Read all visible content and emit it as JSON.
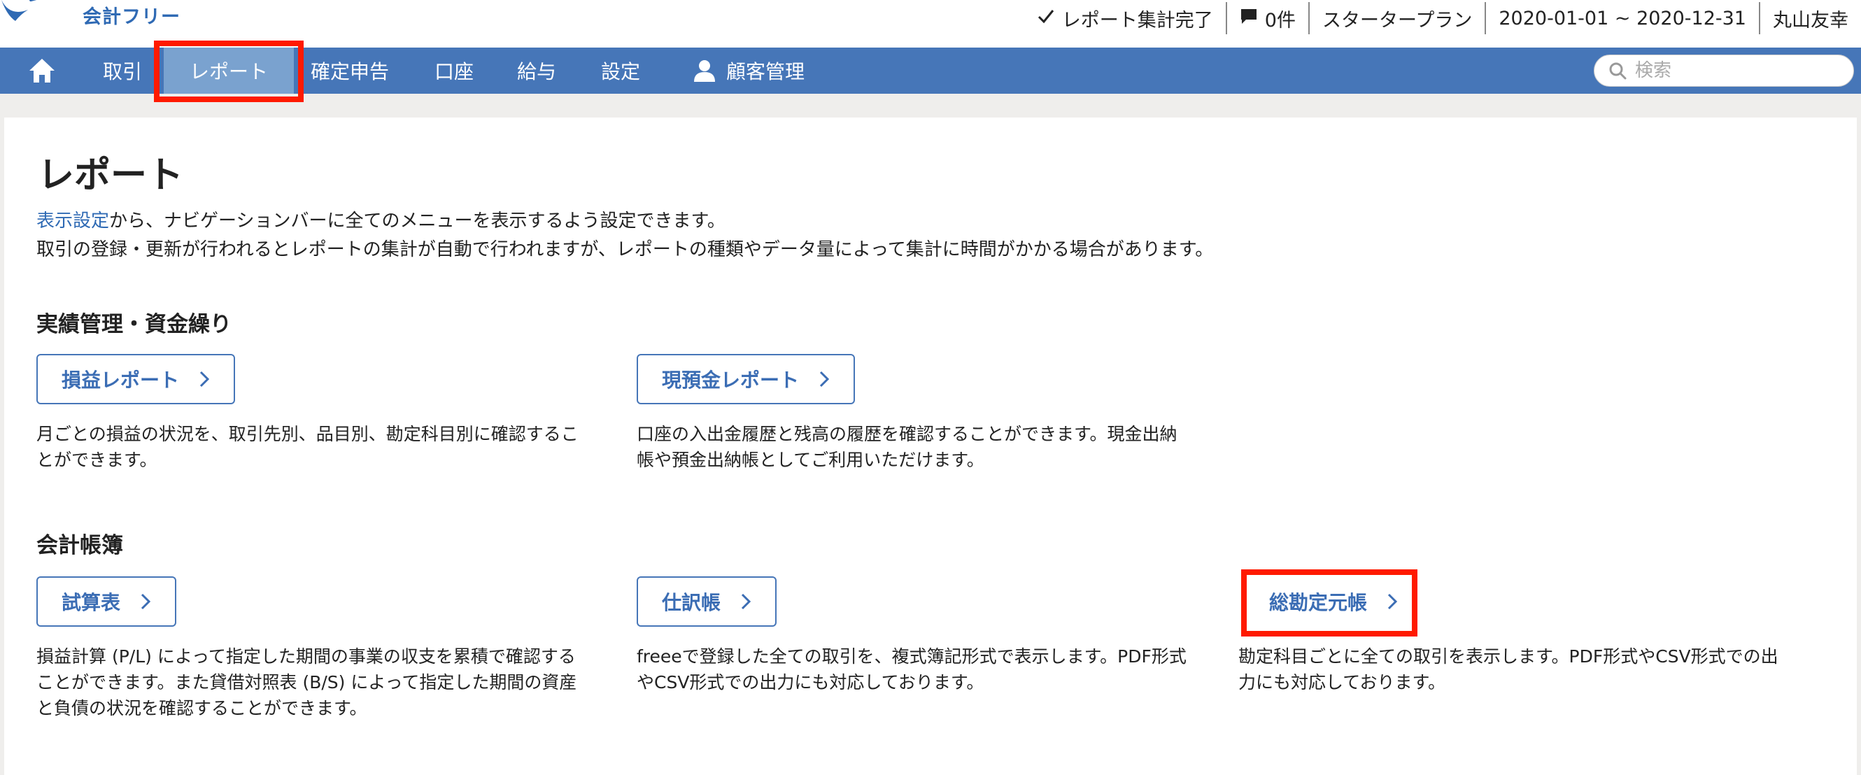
{
  "header": {
    "logo_text": "会計フリー",
    "status": {
      "report_status": "レポート集計完了",
      "message_count": "0件",
      "plan": "スタータープラン",
      "period": "2020-01-01 ~ 2020-12-31",
      "user_name": "丸山友幸"
    }
  },
  "nav": {
    "items": [
      {
        "label": "取引"
      },
      {
        "label": "レポート"
      },
      {
        "label": "確定申告"
      },
      {
        "label": "口座"
      },
      {
        "label": "給与"
      },
      {
        "label": "設定"
      },
      {
        "label": "顧客管理"
      }
    ],
    "active": "レポート",
    "search_placeholder": "検索"
  },
  "page": {
    "title": "レポート",
    "intro_link": "表示設定",
    "intro_line1_rest": "から、ナビゲーションバーに全てのメニューを表示するよう設定できます。",
    "intro_line2": "取引の登録・更新が行われるとレポートの集計が自動で行われますが、レポートの種類やデータ量によって集計に時間がかかる場合があります。"
  },
  "sections": [
    {
      "title": "実績管理・資金繰り",
      "reports": [
        {
          "label": "損益レポート",
          "desc_lines": [
            "月ごとの損益の状況を、取引先別、品目別、勘定科目別に確認するこ",
            "とができます。"
          ]
        },
        {
          "label": "現預金レポート",
          "desc_lines": [
            "口座の入出金履歴と残高の履歴を確認することができます。現金出納",
            "帳や預金出納帳としてご利用いただけます。"
          ]
        }
      ]
    },
    {
      "title": "会計帳簿",
      "reports": [
        {
          "label": "試算表",
          "desc_lines": [
            "損益計算 (P/L) によって指定した期間の事業の収支を累積で確認する",
            "ことができます。また貸借対照表 (B/S) によって指定した期間の資産",
            "と負債の状況を確認することができます。"
          ]
        },
        {
          "label": "仕訳帳",
          "desc_lines": [
            "freeeで登録した全ての取引を、複式簿記形式で表示します。PDF形式",
            "やCSV形式での出力にも対応しております。"
          ]
        },
        {
          "label": "総勘定元帳",
          "desc_lines": [
            "勘定科目ごとに全ての取引を表示します。PDF形式やCSV形式での出",
            "力にも対応しております。"
          ]
        }
      ]
    }
  ],
  "colors": {
    "nav_bg": "#4676b8",
    "nav_active_bg": "#7aa2cf",
    "accent": "#3b6db4",
    "highlight": "#ff1a00"
  },
  "icons": [
    "logo-bird-icon",
    "checkmark-icon",
    "message-icon",
    "home-icon",
    "person-icon",
    "search-icon",
    "chevron-right-icon"
  ]
}
